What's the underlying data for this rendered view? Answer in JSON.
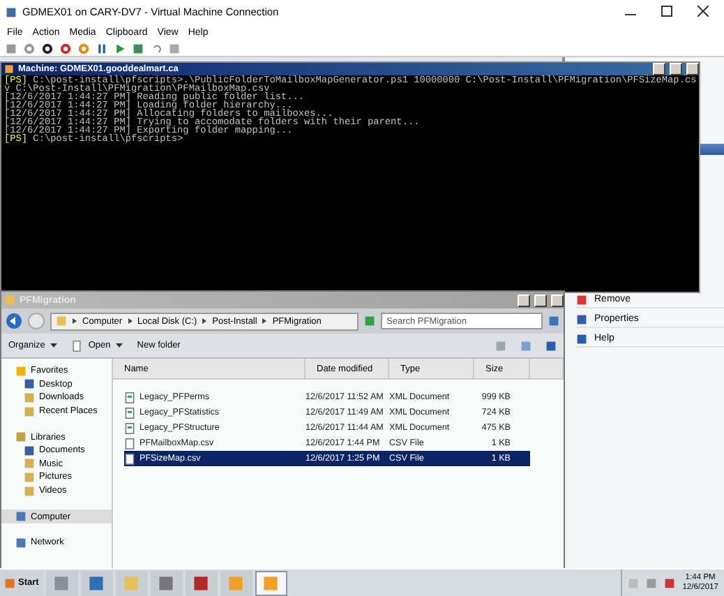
{
  "host_window": {
    "title": "GDMEX01 on CARY-DV7 - Virtual Machine Connection"
  },
  "menu": [
    "File",
    "Action",
    "Media",
    "Clipboard",
    "View",
    "Help"
  ],
  "console": {
    "title": "Machine: GDMEX01.gooddealmart.ca",
    "lines": [
      {
        "prompt": "[PS]",
        "text": " C:\\post-install\\pfscripts>.\\PublicFolderToMailboxMapGenerator.ps1 10000000 C:\\Post-Install\\PFMigration\\PFSizeMap.cs"
      },
      {
        "text": "v C:\\Post-Install\\PFMigration\\PFMailboxMap.csv"
      },
      {
        "text": "[12/6/2017 1:44:27 PM] Reading public folder list..."
      },
      {
        "text": "[12/6/2017 1:44:27 PM] Loading folder hierarchy..."
      },
      {
        "text": "[12/6/2017 1:44:27 PM] Allocating folders to mailboxes..."
      },
      {
        "text": "[12/6/2017 1:44:27 PM] Trying to accomodate folders with their parent..."
      },
      {
        "text": "[12/6/2017 1:44:27 PM] Exporting folder mapping..."
      },
      {
        "prompt": "[PS]",
        "text": " C:\\post-install\\pfscripts>"
      }
    ]
  },
  "actions_pane": {
    "items": [
      "Remove",
      "Properties",
      "Help"
    ]
  },
  "explorer": {
    "title": "PFMigration",
    "breadcrumb": [
      "Computer",
      "Local Disk (C:)",
      "Post-Install",
      "PFMigration"
    ],
    "search": {
      "placeholder": "Search PFMigration"
    },
    "toolbar": [
      {
        "label": "Organize",
        "dropdown": true
      },
      {
        "label": "Open",
        "dropdown": true
      },
      {
        "label": "New folder",
        "dropdown": false
      }
    ],
    "nav": [
      {
        "label": "Favorites",
        "selected": false,
        "children": [
          {
            "label": "Desktop",
            "selected": false
          },
          {
            "label": "Downloads",
            "selected": false
          },
          {
            "label": "Recent Places",
            "selected": false
          }
        ]
      },
      {
        "label": "Libraries",
        "selected": false,
        "children": [
          {
            "label": "Documents",
            "selected": false
          },
          {
            "label": "Music",
            "selected": false
          },
          {
            "label": "Pictures",
            "selected": false
          },
          {
            "label": "Videos",
            "selected": false
          }
        ]
      },
      {
        "label": "Computer",
        "selected": true
      },
      {
        "label": "Network",
        "selected": false
      }
    ],
    "columns": [
      "Name",
      "Date modified",
      "Type",
      "Size"
    ],
    "files": [
      {
        "name": "Legacy_PFPerms",
        "date": "12/6/2017 11:52 AM",
        "type": "XML Document",
        "size": "999 KB",
        "kind": "xml",
        "selected": false
      },
      {
        "name": "Legacy_PFStatistics",
        "date": "12/6/2017 11:49 AM",
        "type": "XML Document",
        "size": "724 KB",
        "kind": "xml",
        "selected": false
      },
      {
        "name": "Legacy_PFStructure",
        "date": "12/6/2017 11:44 AM",
        "type": "XML Document",
        "size": "475 KB",
        "kind": "xml",
        "selected": false
      },
      {
        "name": "PFMailboxMap.csv",
        "date": "12/6/2017 1:44 PM",
        "type": "CSV File",
        "size": "1 KB",
        "kind": "csv",
        "selected": false
      },
      {
        "name": "PFSizeMap.csv",
        "date": "12/6/2017 1:25 PM",
        "type": "CSV File",
        "size": "1 KB",
        "kind": "csv",
        "selected": true
      }
    ]
  },
  "taskbar": {
    "start": "Start",
    "apps": [
      {
        "selected": false
      },
      {
        "selected": false
      },
      {
        "selected": false
      },
      {
        "selected": false
      },
      {
        "selected": false
      },
      {
        "selected": false
      },
      {
        "selected": true
      }
    ],
    "time": "1:44 PM",
    "date": "12/6/2017"
  }
}
